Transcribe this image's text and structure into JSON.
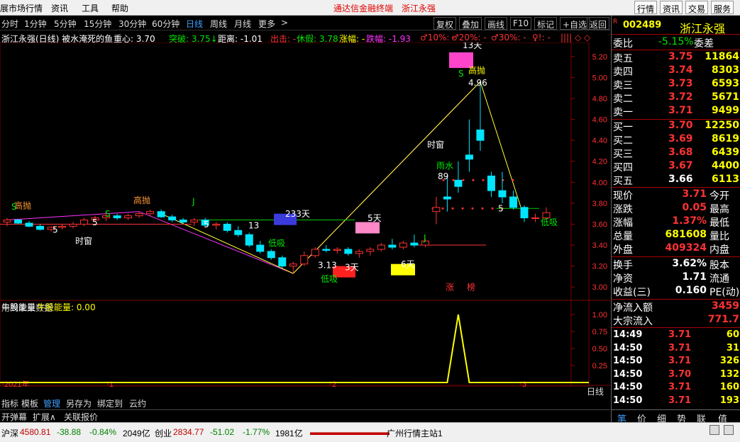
{
  "menu": {
    "items": [
      "展市场行情",
      "资讯",
      "工具",
      "帮助"
    ],
    "promo": [
      "通达信金融终端",
      "浙江永强"
    ],
    "right_buttons": [
      "行情",
      "资讯",
      "交易",
      "服务"
    ]
  },
  "periods": [
    "分时",
    "1分钟",
    "5分钟",
    "15分钟",
    "30分钟",
    "60分钟",
    "日线",
    "周线",
    "月线",
    "更多",
    ">"
  ],
  "active_period": "日线",
  "tools": [
    "复权",
    "叠加",
    "画线",
    "F10",
    "标记",
    "+自选",
    "返回"
  ],
  "indicator_line": {
    "title": "浙江永强(日线) 被水淹死的鱼",
    "zhongxin": "重心: 3.70",
    "tupo": "突破: 3.75↓",
    "juli": "距离: -1.01",
    "chuji": "出击: -",
    "xiujia": "休假: 3.78",
    "zhangfu": "涨幅: -",
    "diefu": "跌幅: -1.93",
    "p10": "♂10%: -",
    "p20": "♂20%: -",
    "p30": "♂30%: -",
    "ex": "♀!: -",
    "mark": "|||| ◇ ◇"
  },
  "sub_indicator": {
    "name": "牛股能量",
    "label": "牛股能量: 0.00"
  },
  "chart_data": {
    "type": "candlestick",
    "price_axis": [
      "5.20",
      "5.00",
      "4.80",
      "4.60",
      "4.40",
      "4.20",
      "4.00",
      "3.80",
      "3.60",
      "3.40",
      "3.20",
      "3.00"
    ],
    "sub_axis": [
      "1.00",
      "0.75",
      "0.50",
      "0.25"
    ],
    "time_labels": [
      "2021年",
      "1",
      "2",
      "3"
    ],
    "annotations": [
      "高抛",
      "高抛",
      "高抛",
      "时窗",
      "时窗",
      "低吸",
      "低吸",
      "低吸",
      "233天",
      "5天",
      "3天",
      "6天",
      "13天",
      "雨水",
      "涨",
      "榜",
      "4.96",
      "3.13",
      "89",
      "13",
      "5",
      "5",
      "5",
      "5",
      "S",
      "S",
      "S",
      "J",
      "J"
    ],
    "future_note": "用到未来数据",
    "ylim": [
      2.9,
      5.28
    ],
    "candles": [
      [
        3.62,
        3.66,
        3.58,
        3.64
      ],
      [
        3.64,
        3.65,
        3.6,
        3.61
      ],
      [
        3.61,
        3.63,
        3.57,
        3.58
      ],
      [
        3.58,
        3.6,
        3.54,
        3.55
      ],
      [
        3.55,
        3.58,
        3.53,
        3.57
      ],
      [
        3.57,
        3.6,
        3.55,
        3.58
      ],
      [
        3.58,
        3.62,
        3.56,
        3.6
      ],
      [
        3.6,
        3.66,
        3.58,
        3.64
      ],
      [
        3.64,
        3.68,
        3.62,
        3.66
      ],
      [
        3.66,
        3.7,
        3.63,
        3.68
      ],
      [
        3.68,
        3.7,
        3.64,
        3.66
      ],
      [
        3.66,
        3.7,
        3.64,
        3.68
      ],
      [
        3.68,
        3.72,
        3.66,
        3.7
      ],
      [
        3.7,
        3.74,
        3.68,
        3.72
      ],
      [
        3.72,
        3.74,
        3.66,
        3.67
      ],
      [
        3.67,
        3.69,
        3.62,
        3.64
      ],
      [
        3.64,
        3.66,
        3.6,
        3.62
      ],
      [
        3.62,
        3.66,
        3.58,
        3.64
      ],
      [
        3.64,
        3.66,
        3.58,
        3.59
      ],
      [
        3.59,
        3.62,
        3.55,
        3.6
      ],
      [
        3.6,
        3.62,
        3.52,
        3.54
      ],
      [
        3.54,
        3.58,
        3.48,
        3.5
      ],
      [
        3.5,
        3.52,
        3.38,
        3.4
      ],
      [
        3.4,
        3.44,
        3.32,
        3.34
      ],
      [
        3.34,
        3.36,
        3.26,
        3.28
      ],
      [
        3.28,
        3.3,
        3.18,
        3.2
      ],
      [
        3.2,
        3.24,
        3.13,
        3.22
      ],
      [
        3.22,
        3.34,
        3.2,
        3.3
      ],
      [
        3.3,
        3.38,
        3.28,
        3.36
      ],
      [
        3.36,
        3.4,
        3.33,
        3.35
      ],
      [
        3.35,
        3.38,
        3.32,
        3.36
      ],
      [
        3.36,
        3.38,
        3.3,
        3.32
      ],
      [
        3.32,
        3.36,
        3.28,
        3.34
      ],
      [
        3.34,
        3.38,
        3.3,
        3.36
      ],
      [
        3.36,
        3.42,
        3.34,
        3.4
      ],
      [
        3.4,
        3.46,
        3.36,
        3.38
      ],
      [
        3.38,
        3.44,
        3.36,
        3.42
      ],
      [
        3.42,
        3.5,
        3.38,
        3.4
      ],
      [
        3.4,
        3.46,
        3.38,
        3.44
      ],
      [
        3.72,
        3.86,
        3.6,
        3.76
      ],
      [
        3.86,
        4.06,
        3.72,
        3.84
      ],
      [
        4.02,
        4.2,
        3.9,
        3.96
      ],
      [
        4.26,
        4.6,
        4.1,
        4.22
      ],
      [
        4.5,
        4.96,
        4.3,
        4.4
      ],
      [
        4.06,
        4.1,
        3.86,
        3.92
      ],
      [
        3.92,
        4.1,
        3.8,
        3.86
      ],
      [
        3.86,
        3.92,
        3.74,
        3.76
      ],
      [
        3.76,
        3.78,
        3.62,
        3.66
      ],
      [
        3.66,
        3.7,
        3.62,
        3.66
      ],
      [
        3.66,
        3.76,
        3.64,
        3.71
      ]
    ],
    "up_color": "#ff3232",
    "down_color": "#00e5ff",
    "sub_values": [
      0,
      0,
      0,
      0,
      0,
      0,
      0,
      0,
      0,
      0,
      0,
      0,
      0,
      0,
      0,
      0,
      0,
      0,
      0,
      0,
      0,
      0,
      0,
      0,
      0,
      0,
      0,
      0,
      0,
      0,
      0,
      0,
      0,
      0,
      0,
      0,
      0,
      0,
      0,
      0,
      0,
      1,
      0,
      0,
      0,
      0,
      0,
      0,
      0,
      0
    ],
    "period_label": "日线"
  },
  "quote": {
    "code": "002489",
    "name": "浙江永强",
    "weibi_label": "委比",
    "weibi": "-5.15%",
    "weicha_label": "委差",
    "asks": [
      {
        "label": "卖五",
        "price": "3.75",
        "vol": "11864"
      },
      {
        "label": "卖四",
        "price": "3.74",
        "vol": "8303"
      },
      {
        "label": "卖三",
        "price": "3.73",
        "vol": "6593"
      },
      {
        "label": "卖二",
        "price": "3.72",
        "vol": "5671"
      },
      {
        "label": "卖一",
        "price": "3.71",
        "vol": "9499"
      }
    ],
    "bids": [
      {
        "label": "买一",
        "price": "3.70",
        "vol": "12250"
      },
      {
        "label": "买二",
        "price": "3.69",
        "vol": "8619"
      },
      {
        "label": "买三",
        "price": "3.68",
        "vol": "6439"
      },
      {
        "label": "买四",
        "price": "3.67",
        "vol": "4400"
      },
      {
        "label": "买五",
        "price": "3.66",
        "vol": "6113"
      }
    ],
    "stats": [
      {
        "l1": "现价",
        "v1": "3.71",
        "l2": "今开"
      },
      {
        "l1": "涨跌",
        "v1": "0.05",
        "l2": "最高"
      },
      {
        "l1": "涨幅",
        "v1": "1.37%",
        "l2": "最低"
      },
      {
        "l1": "总量",
        "v1": "681608",
        "l2": "量比"
      },
      {
        "l1": "外盘",
        "v1": "409324",
        "l2": "内盘"
      }
    ],
    "stats2": [
      {
        "l1": "换手",
        "v1": "3.62%",
        "l2": "股本"
      },
      {
        "l1": "净资",
        "v1": "1.71",
        "l2": "流通"
      },
      {
        "l1": "收益(三)",
        "v1": "0.160",
        "l2": "PE(动)"
      }
    ],
    "flows": [
      {
        "label": "净流入额",
        "value": "3459"
      },
      {
        "label": "大宗流入",
        "value": "771.7"
      }
    ],
    "ticks": [
      {
        "time": "14:49",
        "price": "3.71",
        "vol": "60"
      },
      {
        "time": "14:50",
        "price": "3.71",
        "vol": "31"
      },
      {
        "time": "14:50",
        "price": "3.71",
        "vol": "326"
      },
      {
        "time": "14:50",
        "price": "3.70",
        "vol": "132"
      },
      {
        "time": "14:50",
        "price": "3.71",
        "vol": "160"
      },
      {
        "time": "14:50",
        "price": "3.71",
        "vol": "193"
      }
    ],
    "bottom_tabs": [
      "笔",
      "价",
      "细",
      "势",
      "联",
      "值"
    ]
  },
  "tabs": [
    "指标",
    "模板",
    "管理",
    "另存为",
    "绑定到",
    "云约"
  ],
  "active_tab": "管理",
  "subtabs": [
    "开弹幕",
    "扩展∧",
    "关联报价"
  ],
  "status": {
    "sh_label": "沪深",
    "sh_value": "4580.81",
    "sh_chg": "-38.88",
    "sh_pct": "-0.84%",
    "sh_amt": "2049亿",
    "cy_label": "创业",
    "cy_value": "2834.77",
    "cy_chg": "-51.02",
    "cy_pct": "-1.77%",
    "cy_amt": "1981亿",
    "server": "广州行情主站1"
  }
}
